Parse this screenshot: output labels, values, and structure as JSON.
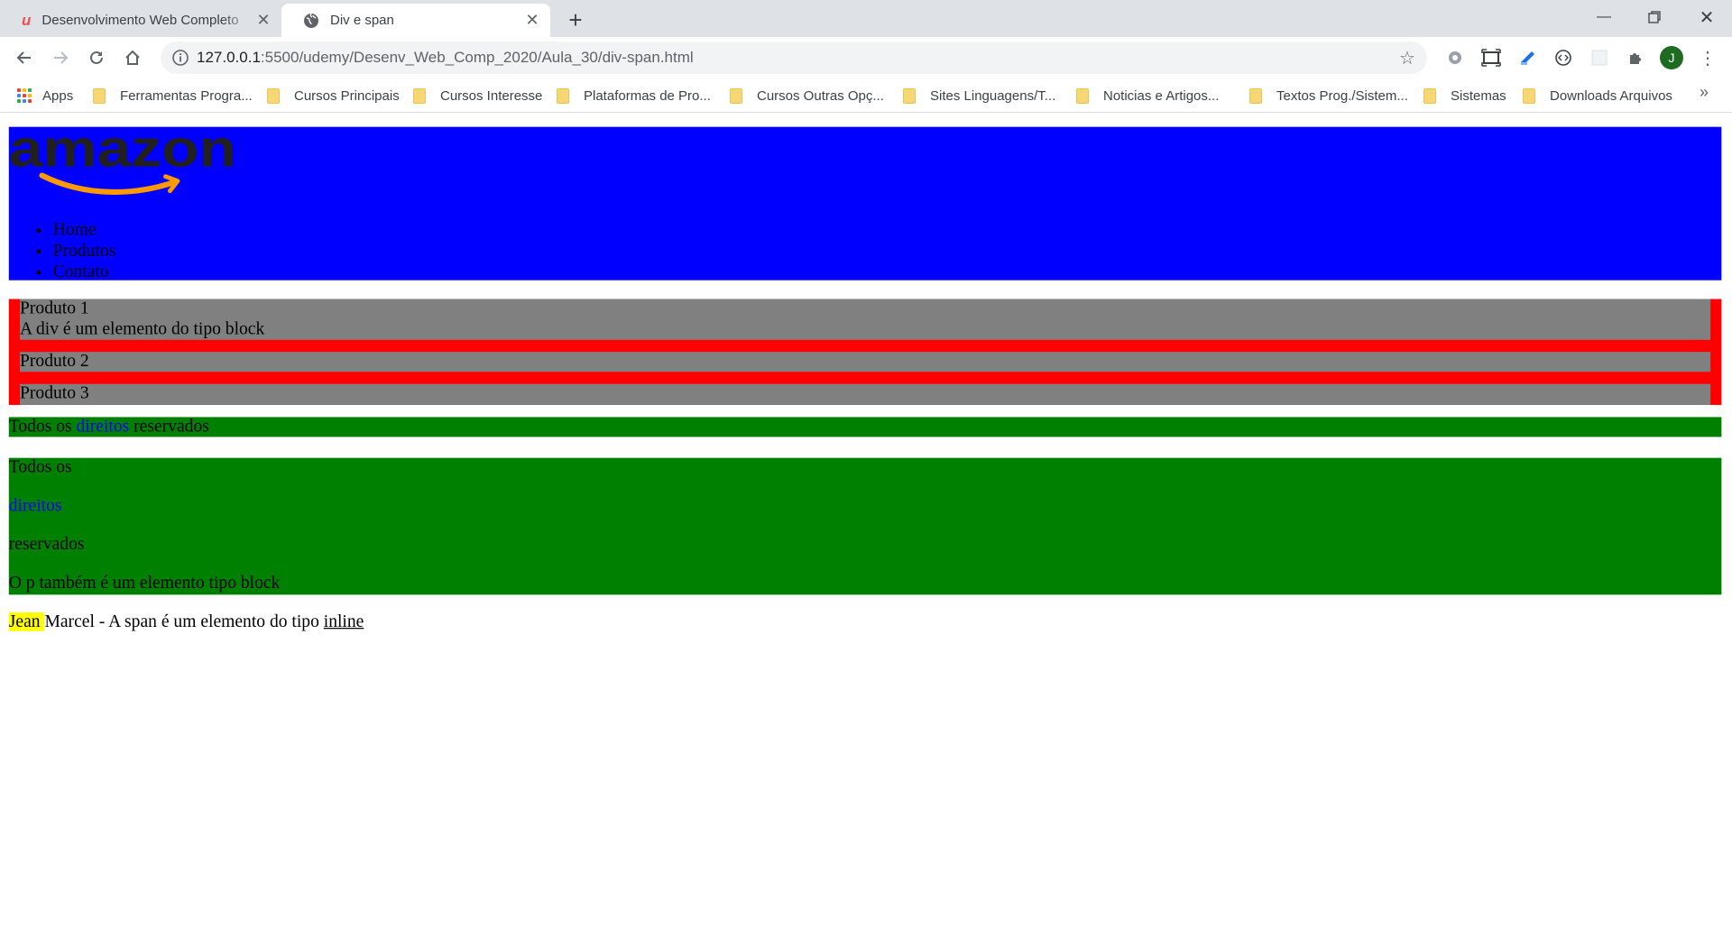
{
  "browser": {
    "tabs": [
      {
        "title": "Desenvolvimento Web Completo",
        "active": false,
        "icon": "udemy-icon"
      },
      {
        "title": "Div e span",
        "active": true,
        "icon": "globe-icon"
      }
    ],
    "url_host": "127.0.0.1",
    "url_path": ":5500/udemy/Desenv_Web_Comp_2020/Aula_30/div-span.html",
    "profile_initial": "J",
    "bookmarks": [
      "Apps",
      "Ferramentas Progra...",
      "Cursos Principais",
      "Cursos Interesse",
      "Plataformas de Pro...",
      "Cursos Outras Opç...",
      "Sites Linguagens/T...",
      "Noticias e Artigos...",
      "Textos Prog./Sistem...",
      "Sistemas",
      "Downloads Arquivos"
    ],
    "bookmarks_more": "»"
  },
  "page": {
    "menu": [
      "Home",
      "Produtos",
      "Contato"
    ],
    "produtos": {
      "p1": "Produto 1",
      "p1_note": "A div é um elemento do tipo block",
      "p2": "Produto 2",
      "p3": "Produto 3"
    },
    "footer1": {
      "a": "Todos os",
      "link": "direitos",
      "b": "reservados"
    },
    "footer2": {
      "a": "Todos os",
      "link": "direitos",
      "b": "reservados",
      "note": "O p também é um elemento tipo block"
    },
    "signature": {
      "highlight": "Jean",
      "rest": "Marcel - A span é um elemento do tipo",
      "underlined": "inline"
    }
  },
  "colors": {
    "header_bg": "#0000ff",
    "produtos_bg": "#ff0000",
    "produto_bg": "#808080",
    "footer_bg": "#008000",
    "highlight_bg": "#ffff00"
  }
}
